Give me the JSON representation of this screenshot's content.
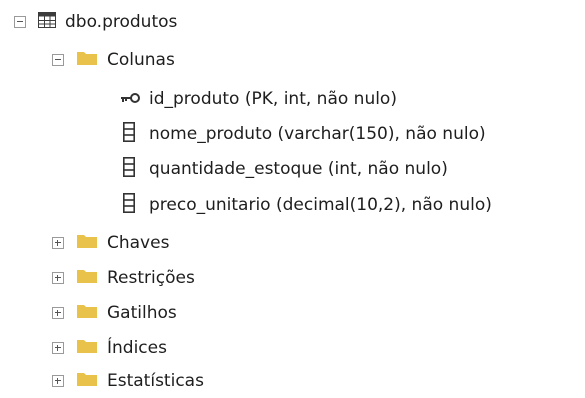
{
  "tree": {
    "table": {
      "label": "dbo.produtos",
      "icon": "table-icon",
      "expanded": true
    },
    "columns_folder": {
      "label": "Colunas",
      "icon": "folder-icon",
      "expanded": true
    },
    "columns": [
      {
        "label": "id_produto (PK, int, não nulo)",
        "icon": "key-icon"
      },
      {
        "label": "nome_produto (varchar(150), não nulo)",
        "icon": "column-icon"
      },
      {
        "label": "quantidade_estoque (int, não nulo)",
        "icon": "column-icon"
      },
      {
        "label": "preco_unitario (decimal(10,2), não nulo)",
        "icon": "column-icon"
      }
    ],
    "folders": [
      {
        "label": "Chaves",
        "icon": "folder-icon",
        "expanded": false
      },
      {
        "label": "Restrições",
        "icon": "folder-icon",
        "expanded": false
      },
      {
        "label": "Gatilhos",
        "icon": "folder-icon",
        "expanded": false
      },
      {
        "label": "Índices",
        "icon": "folder-icon",
        "expanded": false
      },
      {
        "label": "Estatísticas",
        "icon": "folder-icon",
        "expanded": false
      }
    ]
  },
  "colors": {
    "folder": "#e8c24a",
    "table_grid": "#3c3c3c",
    "text": "#1e1e1e"
  }
}
